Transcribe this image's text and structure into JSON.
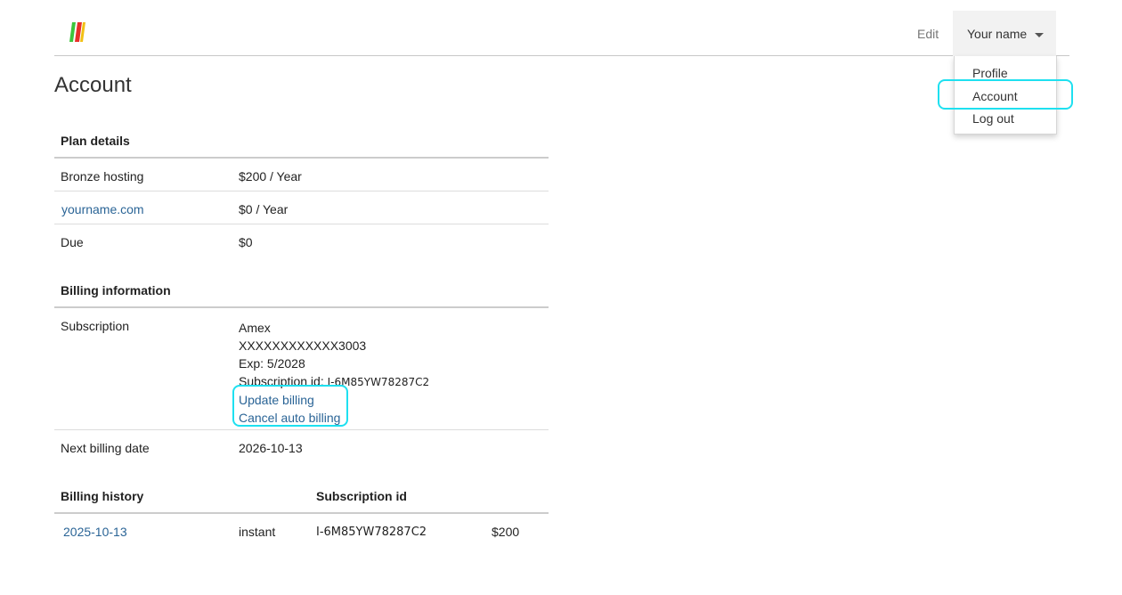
{
  "nav": {
    "edit_label": "Edit",
    "user_label": "Your name",
    "dropdown_items": [
      "Profile",
      "Account",
      "Log out"
    ]
  },
  "page": {
    "title": "Account"
  },
  "plan": {
    "heading": "Plan details",
    "rows": [
      {
        "label": "Bronze hosting",
        "value": "$200 / Year"
      },
      {
        "label": "yourname.com",
        "value": "$0 / Year"
      },
      {
        "label": "Due",
        "value": "$0"
      }
    ]
  },
  "billing": {
    "heading": "Billing information",
    "subscription_label": "Subscription",
    "card_type": "Amex",
    "card_number": "XXXXXXXXXXXX3003",
    "expiry": "Exp: 5/2028",
    "subscription_id_label": "Subscription id:",
    "subscription_id": "I-6M85YW78287C2",
    "update_link": "Update billing",
    "cancel_link": "Cancel auto billing",
    "next_date_label": "Next billing date",
    "next_date_value": "2026-10-13"
  },
  "history": {
    "heading": "Billing history",
    "col_subscription": "Subscription id",
    "rows": [
      {
        "date": "2025-10-13",
        "type": "instant",
        "subscription_id": "I-6M85YW78287C2",
        "amount": "$200"
      }
    ]
  },
  "colors": {
    "link": "#2a6496",
    "highlight": "#1ee0f0",
    "logo_green": "#3cc63c",
    "logo_red": "#e8302a",
    "logo_yellow": "#f2c012"
  }
}
